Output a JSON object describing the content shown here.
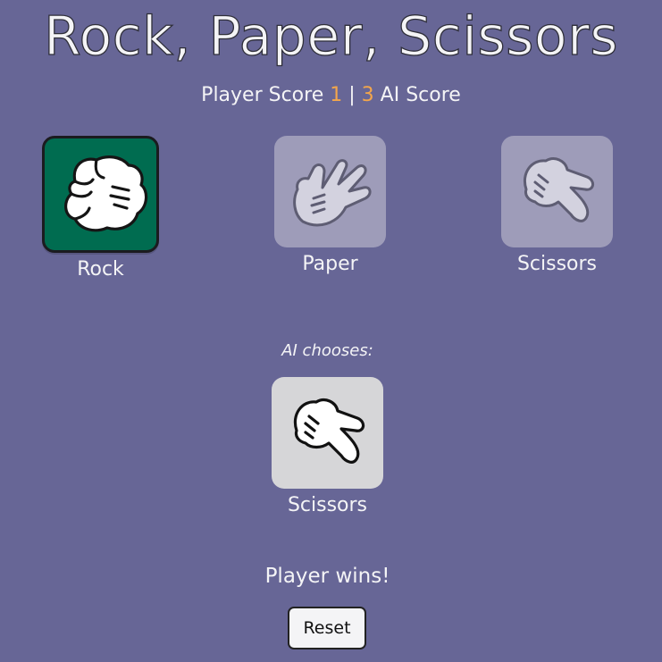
{
  "game": {
    "title": "Rock, Paper, Scissors"
  },
  "score": {
    "player_label": "Player Score",
    "player_value": "1",
    "separator": "|",
    "ai_value": "3",
    "ai_label": "AI Score"
  },
  "choices": [
    {
      "label": "Rock",
      "icon": "rock-fist-icon",
      "selected": true
    },
    {
      "label": "Paper",
      "icon": "paper-hand-icon",
      "selected": false
    },
    {
      "label": "Scissors",
      "icon": "scissors-hand-icon",
      "selected": false
    }
  ],
  "ai": {
    "prompt": "AI chooses:",
    "choice_label": "Scissors",
    "choice_icon": "scissors-hand-icon"
  },
  "result": {
    "message": "Player wins!"
  },
  "controls": {
    "reset_label": "Reset"
  },
  "colors": {
    "background": "#676696",
    "selected_card": "#006c50",
    "unselected_card": "#9e9cb9",
    "ai_card": "#d6d6d8",
    "score_accent": "#f3a64b"
  }
}
